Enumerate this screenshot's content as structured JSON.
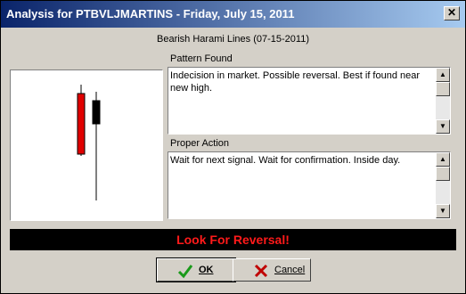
{
  "window": {
    "title": "Analysis for PTBVLJMARTINS - Friday, July 15, 2011",
    "close_label": "✕"
  },
  "subtitle": "Bearish Harami Lines (07-15-2011)",
  "pattern_found": {
    "label": "Pattern Found",
    "text": "Indecision in market. Possible reversal. Best if found near new high."
  },
  "proper_action": {
    "label": "Proper Action",
    "text": "Wait for next signal. Wait for confirmation. Inside day."
  },
  "banner": "Look For Reversal!",
  "buttons": {
    "ok": "OK",
    "cancel": "Cancel"
  },
  "chart_data": {
    "type": "candlestick",
    "candles": [
      {
        "name": "day1",
        "color": "#e00000",
        "body": "bullish"
      },
      {
        "name": "day2",
        "color": "#000000",
        "body": "bearish"
      }
    ]
  },
  "colors": {
    "banner_text": "#ff1a1a",
    "banner_bg": "#000000",
    "ok_icon": "#1a9a1a",
    "cancel_icon": "#c00000"
  }
}
